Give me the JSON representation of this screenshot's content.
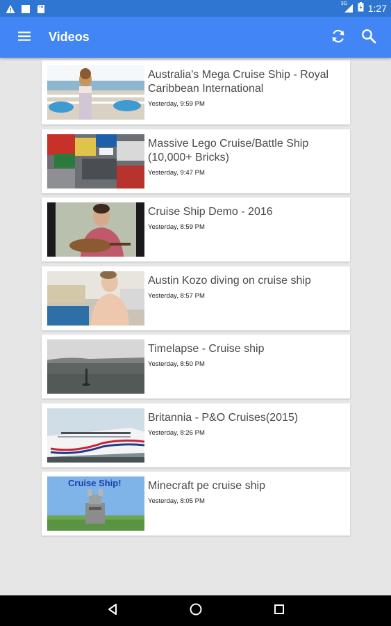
{
  "status_bar": {
    "time": "1:27",
    "signal_label": "3G",
    "icons": [
      "warning-icon",
      "square-notification-icon",
      "sd-card-icon",
      "signal-icon",
      "battery-icon"
    ]
  },
  "app_bar": {
    "title": "Videos",
    "color": "#4285f4",
    "status_color": "#2f76d2",
    "icons": [
      "menu-icon",
      "refresh-icon",
      "search-icon"
    ]
  },
  "videos": [
    {
      "title": "Australia's Mega Cruise Ship - Royal Caribbean International",
      "time": "Yesterday, 9:59 PM"
    },
    {
      "title": "Massive Lego Cruise/Battle Ship (10,000+ Bricks)",
      "time": "Yesterday, 9:47 PM"
    },
    {
      "title": "Cruise Ship Demo - 2016",
      "time": "Yesterday, 8:59 PM"
    },
    {
      "title": "Austin Kozo diving on cruise ship",
      "time": "Yesterday, 8:57 PM"
    },
    {
      "title": "Timelapse - Cruise ship",
      "time": "Yesterday, 8:50 PM"
    },
    {
      "title": "Britannia - P&O Cruises(2015)",
      "time": "Yesterday, 8:26 PM"
    },
    {
      "title": "Minecraft pe cruise ship",
      "time": "Yesterday, 8:05 PM"
    }
  ],
  "thumbnail_caption_7": "Cruise Ship!",
  "nav_bar": {
    "icons": [
      "back-icon",
      "home-icon",
      "recents-icon"
    ]
  }
}
